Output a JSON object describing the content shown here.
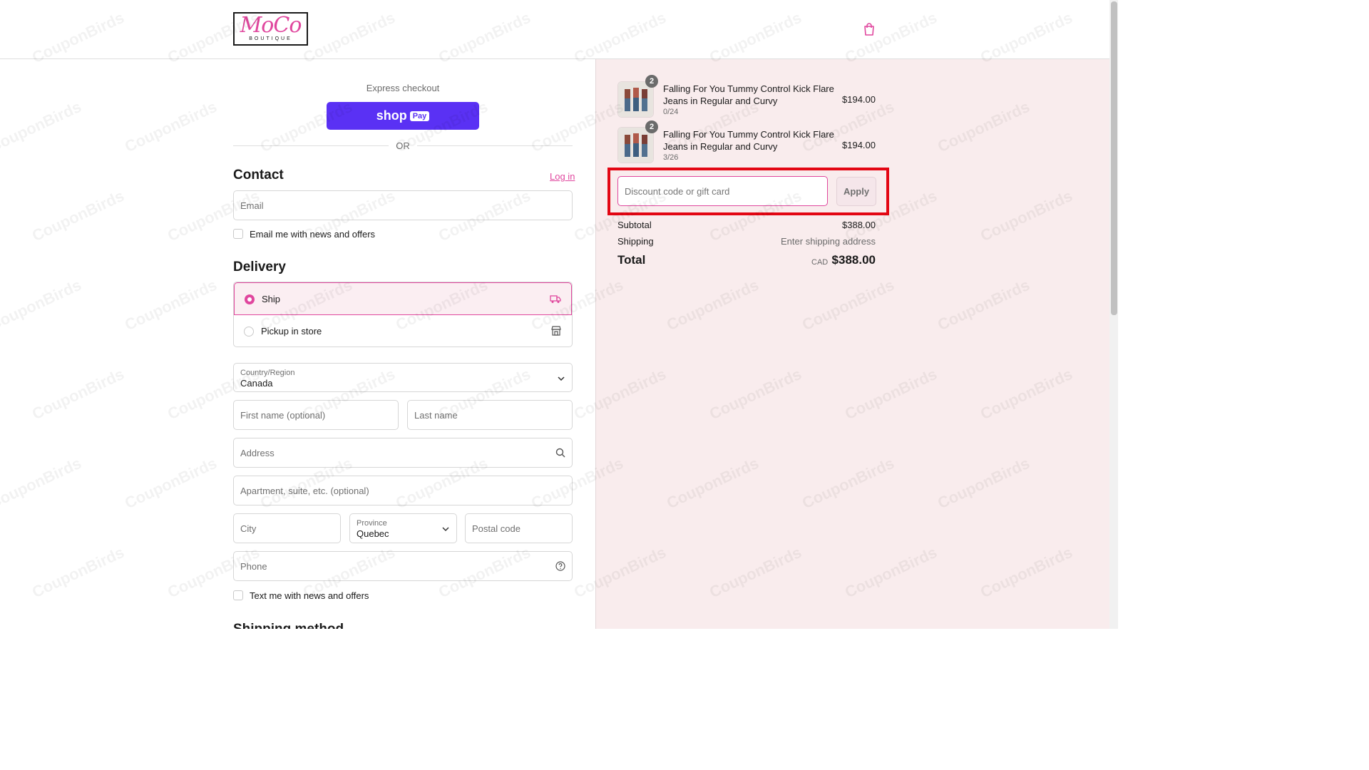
{
  "header": {
    "logo_main": "MoCo",
    "logo_sub": "BOUTIQUE"
  },
  "express": {
    "label": "Express checkout",
    "shoppay_shop": "shop",
    "shoppay_pay": "Pay",
    "or": "OR"
  },
  "contact": {
    "title": "Contact",
    "login": "Log in",
    "email_placeholder": "Email",
    "news_label": "Email me with news and offers"
  },
  "delivery": {
    "title": "Delivery",
    "options": [
      {
        "label": "Ship",
        "selected": true,
        "icon": "truck-icon"
      },
      {
        "label": "Pickup in store",
        "selected": false,
        "icon": "store-icon"
      }
    ],
    "country_label": "Country/Region",
    "country_value": "Canada",
    "first_name_placeholder": "First name (optional)",
    "last_name_placeholder": "Last name",
    "address_placeholder": "Address",
    "apartment_placeholder": "Apartment, suite, etc. (optional)",
    "city_placeholder": "City",
    "province_label": "Province",
    "province_value": "Quebec",
    "postal_placeholder": "Postal code",
    "phone_placeholder": "Phone",
    "text_label": "Text me with news and offers",
    "shipping_method_title": "Shipping method"
  },
  "order": {
    "items": [
      {
        "name": "Falling For You Tummy Control Kick Flare Jeans in Regular and Curvy",
        "variant": "0/24",
        "qty": "2",
        "price": "$194.00"
      },
      {
        "name": "Falling For You Tummy Control Kick Flare Jeans in Regular and Curvy",
        "variant": "3/26",
        "qty": "2",
        "price": "$194.00"
      }
    ],
    "discount_placeholder": "Discount code or gift card",
    "apply": "Apply",
    "subtotal_label": "Subtotal",
    "subtotal_value": "$388.00",
    "shipping_label": "Shipping",
    "shipping_value": "Enter shipping address",
    "total_label": "Total",
    "currency": "CAD",
    "total_value": "$388.00"
  },
  "watermark": "CouponBirds",
  "colors": {
    "accent": "#e0479e",
    "shoppay": "#5a31f4",
    "summary_bg": "#f9eced",
    "highlight": "#e30613"
  }
}
